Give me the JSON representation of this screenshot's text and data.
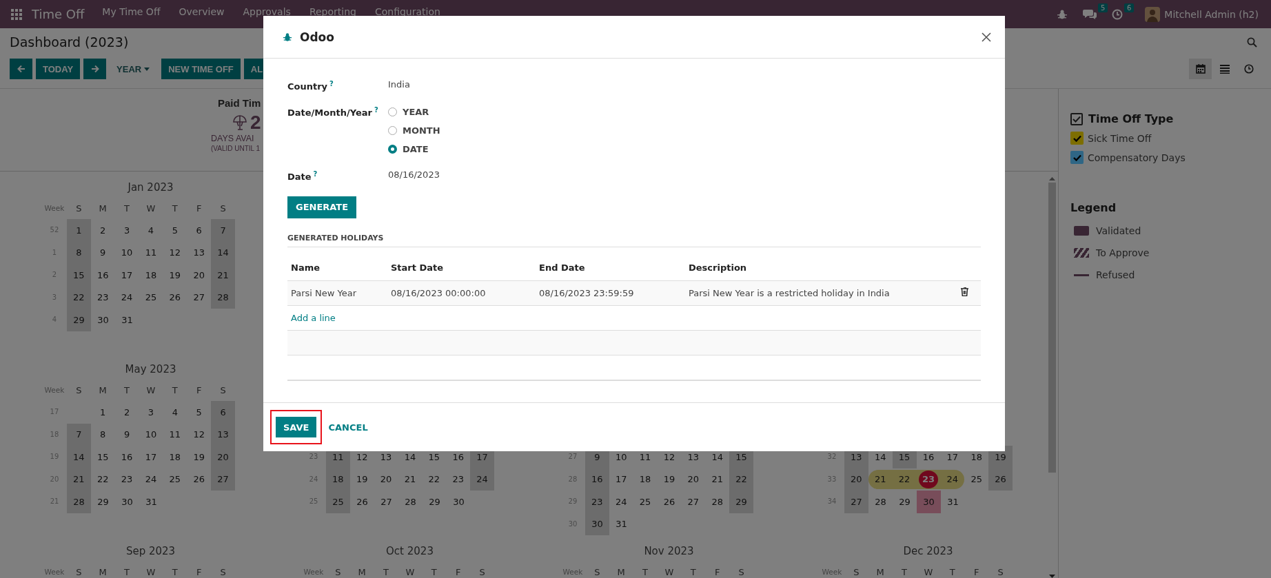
{
  "navbar": {
    "app_name": "Time Off",
    "menu": [
      {
        "label": "My Time Off"
      },
      {
        "label": "Overview"
      },
      {
        "label": "Approvals"
      },
      {
        "label": "Reporting"
      },
      {
        "label": "Configuration"
      }
    ],
    "messages_badge": "5",
    "activities_badge": "6",
    "user_name": "Mitchell Admin (h2)"
  },
  "control_panel": {
    "title": "Dashboard (2023)",
    "buttons": [
      {
        "kind": "prev"
      },
      {
        "kind": "text",
        "label": "TODAY"
      },
      {
        "kind": "next"
      },
      {
        "kind": "dropdown",
        "label": "YEAR"
      },
      {
        "kind": "text",
        "label": "NEW TIME OFF"
      },
      {
        "kind": "text",
        "label": "AL"
      }
    ],
    "views": [
      {
        "kind": "calendar",
        "selected": true
      },
      {
        "kind": "list",
        "selected": false
      },
      {
        "kind": "activity",
        "selected": false
      }
    ]
  },
  "summary": {
    "title": "Paid Tim",
    "amount": "2",
    "caption": "DAYS AVAI",
    "validity": "(VALID UNTIL 1"
  },
  "calendar": {
    "month_rows": [
      {
        "months": [
          {
            "title": "Jan 2023",
            "week_label": "Week",
            "weekdays": [
              "S",
              "M",
              "T",
              "W",
              "T",
              "F",
              "S"
            ],
            "rows": [
              {
                "week": "52",
                "days": [
                  {
                    "d": "1",
                    "kind": "weekend"
                  },
                  {
                    "d": "2",
                    "kind": "plain"
                  },
                  {
                    "d": "3",
                    "kind": "plain"
                  },
                  {
                    "d": "4",
                    "kind": "plain"
                  },
                  {
                    "d": "5",
                    "kind": "plain"
                  },
                  {
                    "d": "6",
                    "kind": "plain"
                  },
                  {
                    "d": "7",
                    "kind": "weekend"
                  }
                ]
              },
              {
                "week": "1",
                "days": [
                  {
                    "d": "8",
                    "kind": "weekend"
                  },
                  {
                    "d": "9",
                    "kind": "plain"
                  },
                  {
                    "d": "10",
                    "kind": "plain"
                  },
                  {
                    "d": "11",
                    "kind": "plain"
                  },
                  {
                    "d": "12",
                    "kind": "plain"
                  },
                  {
                    "d": "13",
                    "kind": "plain"
                  },
                  {
                    "d": "14",
                    "kind": "weekend"
                  }
                ]
              },
              {
                "week": "2",
                "days": [
                  {
                    "d": "15",
                    "kind": "weekend"
                  },
                  {
                    "d": "16",
                    "kind": "plain"
                  },
                  {
                    "d": "17",
                    "kind": "plain"
                  },
                  {
                    "d": "18",
                    "kind": "plain"
                  },
                  {
                    "d": "19",
                    "kind": "plain"
                  },
                  {
                    "d": "20",
                    "kind": "plain"
                  },
                  {
                    "d": "21",
                    "kind": "weekend"
                  }
                ]
              },
              {
                "week": "3",
                "days": [
                  {
                    "d": "22",
                    "kind": "weekend"
                  },
                  {
                    "d": "23",
                    "kind": "plain"
                  },
                  {
                    "d": "24",
                    "kind": "plain"
                  },
                  {
                    "d": "25",
                    "kind": "plain"
                  },
                  {
                    "d": "26",
                    "kind": "plain"
                  },
                  {
                    "d": "27",
                    "kind": "plain"
                  },
                  {
                    "d": "28",
                    "kind": "weekend"
                  }
                ]
              },
              {
                "week": "4",
                "days": [
                  {
                    "d": "29",
                    "kind": "weekend"
                  },
                  {
                    "d": "30",
                    "kind": "plain"
                  },
                  {
                    "d": "31",
                    "kind": "plain"
                  }
                ]
              }
            ]
          }
        ]
      },
      {
        "months": [
          {
            "title": "May 2023",
            "week_label": "Week",
            "weekdays": [
              "S",
              "M",
              "T",
              "W",
              "T",
              "F",
              "S"
            ],
            "rows": [
              {
                "week": "17",
                "days": [
                  {
                    "kind": "empty"
                  },
                  {
                    "d": "1",
                    "kind": "plain"
                  },
                  {
                    "d": "2",
                    "kind": "plain"
                  },
                  {
                    "d": "3",
                    "kind": "plain"
                  },
                  {
                    "d": "4",
                    "kind": "plain"
                  },
                  {
                    "d": "5",
                    "kind": "plain"
                  },
                  {
                    "d": "6",
                    "kind": "weekend"
                  }
                ]
              },
              {
                "week": "18",
                "days": [
                  {
                    "d": "7",
                    "kind": "weekend"
                  },
                  {
                    "d": "8",
                    "kind": "plain"
                  },
                  {
                    "d": "9",
                    "kind": "plain"
                  },
                  {
                    "d": "10",
                    "kind": "plain"
                  },
                  {
                    "d": "11",
                    "kind": "plain"
                  },
                  {
                    "d": "12",
                    "kind": "plain"
                  },
                  {
                    "d": "13",
                    "kind": "weekend"
                  }
                ]
              },
              {
                "week": "19",
                "days": [
                  {
                    "d": "14",
                    "kind": "weekend"
                  },
                  {
                    "d": "15",
                    "kind": "plain"
                  },
                  {
                    "d": "16",
                    "kind": "plain"
                  },
                  {
                    "d": "17",
                    "kind": "plain"
                  },
                  {
                    "d": "18",
                    "kind": "plain"
                  },
                  {
                    "d": "19",
                    "kind": "plain"
                  },
                  {
                    "d": "20",
                    "kind": "weekend"
                  }
                ]
              },
              {
                "week": "20",
                "days": [
                  {
                    "d": "21",
                    "kind": "weekend"
                  },
                  {
                    "d": "22",
                    "kind": "plain"
                  },
                  {
                    "d": "23",
                    "kind": "plain"
                  },
                  {
                    "d": "24",
                    "kind": "plain"
                  },
                  {
                    "d": "25",
                    "kind": "plain"
                  },
                  {
                    "d": "26",
                    "kind": "plain"
                  },
                  {
                    "d": "27",
                    "kind": "weekend"
                  }
                ]
              },
              {
                "week": "21",
                "days": [
                  {
                    "d": "28",
                    "kind": "weekend"
                  },
                  {
                    "d": "29",
                    "kind": "plain"
                  },
                  {
                    "d": "30",
                    "kind": "plain"
                  },
                  {
                    "d": "31",
                    "kind": "plain"
                  }
                ]
              }
            ]
          },
          {
            "rows": [
              {
                "week": "23",
                "days": [
                  {
                    "d": "11",
                    "kind": "weekend"
                  },
                  {
                    "d": "12",
                    "kind": "plain"
                  },
                  {
                    "d": "13",
                    "kind": "plain"
                  },
                  {
                    "d": "14",
                    "kind": "plain"
                  },
                  {
                    "d": "15",
                    "kind": "plain"
                  },
                  {
                    "d": "16",
                    "kind": "plain"
                  },
                  {
                    "d": "17",
                    "kind": "weekend"
                  }
                ]
              },
              {
                "week": "24",
                "days": [
                  {
                    "d": "18",
                    "kind": "weekend"
                  },
                  {
                    "d": "19",
                    "kind": "plain"
                  },
                  {
                    "d": "20",
                    "kind": "plain"
                  },
                  {
                    "d": "21",
                    "kind": "plain"
                  },
                  {
                    "d": "22",
                    "kind": "plain"
                  },
                  {
                    "d": "23",
                    "kind": "plain"
                  },
                  {
                    "d": "24",
                    "kind": "weekend"
                  }
                ]
              },
              {
                "week": "25",
                "days": [
                  {
                    "d": "25",
                    "kind": "weekend"
                  },
                  {
                    "d": "26",
                    "kind": "plain"
                  },
                  {
                    "d": "27",
                    "kind": "plain"
                  },
                  {
                    "d": "28",
                    "kind": "plain"
                  },
                  {
                    "d": "29",
                    "kind": "plain"
                  },
                  {
                    "d": "30",
                    "kind": "plain"
                  }
                ]
              }
            ]
          },
          {
            "rows": [
              {
                "week": "27",
                "days": [
                  {
                    "d": "9",
                    "kind": "weekend"
                  },
                  {
                    "d": "10",
                    "kind": "plain"
                  },
                  {
                    "d": "11",
                    "kind": "plain"
                  },
                  {
                    "d": "12",
                    "kind": "plain"
                  },
                  {
                    "d": "13",
                    "kind": "plain"
                  },
                  {
                    "d": "14",
                    "kind": "plain"
                  },
                  {
                    "d": "15",
                    "kind": "weekend"
                  }
                ]
              },
              {
                "week": "28",
                "days": [
                  {
                    "d": "16",
                    "kind": "weekend"
                  },
                  {
                    "d": "17",
                    "kind": "plain"
                  },
                  {
                    "d": "18",
                    "kind": "plain"
                  },
                  {
                    "d": "19",
                    "kind": "plain"
                  },
                  {
                    "d": "20",
                    "kind": "plain"
                  },
                  {
                    "d": "21",
                    "kind": "plain"
                  },
                  {
                    "d": "22",
                    "kind": "weekend"
                  }
                ]
              },
              {
                "week": "29",
                "days": [
                  {
                    "d": "23",
                    "kind": "weekend"
                  },
                  {
                    "d": "24",
                    "kind": "plain"
                  },
                  {
                    "d": "25",
                    "kind": "plain"
                  },
                  {
                    "d": "26",
                    "kind": "plain"
                  },
                  {
                    "d": "27",
                    "kind": "plain"
                  },
                  {
                    "d": "28",
                    "kind": "plain"
                  },
                  {
                    "d": "29",
                    "kind": "weekend"
                  }
                ]
              },
              {
                "week": "30",
                "days": [
                  {
                    "d": "30",
                    "kind": "weekend"
                  },
                  {
                    "d": "31",
                    "kind": "plain"
                  }
                ]
              }
            ]
          },
          {
            "rows": [
              {
                "week": "32",
                "days": [
                  {
                    "d": "13",
                    "kind": "weekend"
                  },
                  {
                    "d": "14",
                    "kind": "plain"
                  },
                  {
                    "d": "15",
                    "kind": "holiday"
                  },
                  {
                    "d": "16",
                    "kind": "plain"
                  },
                  {
                    "d": "17",
                    "kind": "plain"
                  },
                  {
                    "d": "18",
                    "kind": "plain"
                  },
                  {
                    "d": "19",
                    "kind": "weekend"
                  }
                ]
              },
              {
                "week": "33",
                "days": [
                  {
                    "d": "20",
                    "kind": "weekend"
                  },
                  {
                    "d": "21",
                    "kind": "leave_start"
                  },
                  {
                    "d": "22",
                    "kind": "leave"
                  },
                  {
                    "d": "23",
                    "kind": "today"
                  },
                  {
                    "d": "24",
                    "kind": "leave_end"
                  },
                  {
                    "d": "25",
                    "kind": "plain"
                  },
                  {
                    "d": "26",
                    "kind": "weekend"
                  }
                ]
              },
              {
                "week": "34",
                "days": [
                  {
                    "d": "27",
                    "kind": "weekend"
                  },
                  {
                    "d": "28",
                    "kind": "plain"
                  },
                  {
                    "d": "29",
                    "kind": "plain"
                  },
                  {
                    "d": "30",
                    "kind": "pending"
                  },
                  {
                    "d": "31",
                    "kind": "plain"
                  }
                ]
              }
            ]
          }
        ]
      },
      {
        "months": [
          {
            "title": "Sep 2023",
            "week_label": "Week",
            "weekdays": [
              "S",
              "M",
              "T",
              "W",
              "T",
              "F",
              "S"
            ]
          },
          {
            "title": "Oct 2023",
            "week_label": "Week",
            "weekdays": [
              "S",
              "M",
              "T",
              "W",
              "T",
              "F",
              "S"
            ]
          },
          {
            "title": "Nov 2023",
            "week_label": "Week",
            "weekdays": [
              "S",
              "M",
              "T",
              "W",
              "T",
              "F",
              "S"
            ]
          },
          {
            "title": "Dec 2023",
            "week_label": "Week",
            "weekdays": [
              "S",
              "M",
              "T",
              "W",
              "T",
              "F",
              "S"
            ]
          }
        ]
      }
    ]
  },
  "sidebar": {
    "filter": {
      "title": "Time Off Type",
      "checked": true,
      "items": [
        {
          "label": "Sick Time Off",
          "checked": true,
          "color": "#7d6e00"
        },
        {
          "label": "Compensatory Days",
          "checked": true,
          "color": "#2f6685"
        }
      ]
    },
    "legend": {
      "title": "Legend",
      "items": [
        {
          "label": "Validated",
          "kind": "validated"
        },
        {
          "label": "To Approve",
          "kind": "to_approve"
        },
        {
          "label": "Refused",
          "kind": "refused"
        }
      ]
    }
  },
  "dialog": {
    "title": "Odoo",
    "fields": [
      {
        "kind": "text",
        "label": "Country",
        "help": "?",
        "value": "India"
      },
      {
        "kind": "radio",
        "label": "Date/Month/Year",
        "help": "?",
        "options": [
          {
            "label": "YEAR",
            "selected": false
          },
          {
            "label": "MONTH",
            "selected": false
          },
          {
            "label": "DATE",
            "selected": true
          }
        ]
      },
      {
        "kind": "text",
        "label": "Date",
        "help": "?",
        "value": "08/16/2023"
      }
    ],
    "generate_button": "GENERATE",
    "section_title": "GENERATED HOLIDAYS",
    "table": {
      "columns": [
        "Name",
        "Start Date",
        "End Date",
        "Description"
      ],
      "rows": [
        {
          "cells": [
            "Parsi New Year",
            "08/16/2023 00:00:00",
            "08/16/2023 23:59:59",
            "Parsi New Year is a restricted holiday in India"
          ]
        }
      ],
      "add_line": "Add a line"
    },
    "footer": {
      "save": "SAVE",
      "cancel": "CANCEL",
      "save_highlighted": true
    }
  }
}
